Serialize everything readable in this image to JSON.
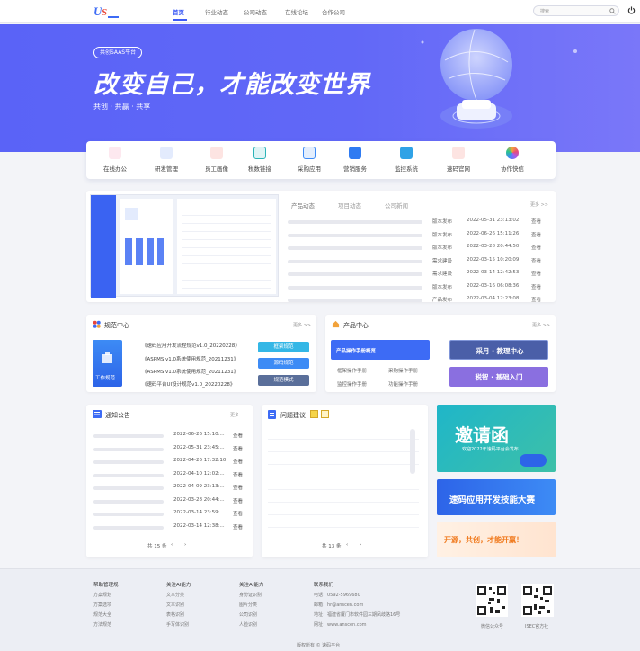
{
  "nav": {
    "items": [
      "首页",
      "行业动态",
      "公司动态",
      "在线论坛",
      "合作公司"
    ],
    "active": 0,
    "search_placeholder": "搜索"
  },
  "hero": {
    "badge": "共创SAAS平台",
    "title": "改变自己，才能改变世界",
    "subtitle": "共创 · 共赢 · 共享"
  },
  "apps": [
    {
      "label": "在线办公",
      "icon": "w-logo-icon",
      "color": "#e84a7a"
    },
    {
      "label": "研发管理",
      "icon": "u-logo-icon",
      "color": "#3d6bf5"
    },
    {
      "label": "员工画像",
      "icon": "id-card-icon",
      "color": "#e8453c"
    },
    {
      "label": "税数链接",
      "icon": "gear-box-icon",
      "color": "#2bb3b8"
    },
    {
      "label": "采购应用",
      "icon": "cart-icon",
      "color": "#3d8bf5"
    },
    {
      "label": "营销服务",
      "icon": "compass-icon",
      "color": "#2f7bf2"
    },
    {
      "label": "监控系统",
      "icon": "monitor-icon",
      "color": "#2fa2e6"
    },
    {
      "label": "速码官网",
      "icon": "u-logo-icon",
      "color": "#e8453c"
    },
    {
      "label": "协作快信",
      "icon": "circle-icon",
      "color": "#a35cf0"
    }
  ],
  "news": {
    "tabs": [
      "产品动态",
      "项目动态",
      "公司新闻"
    ],
    "more": "更多 >>",
    "rows": [
      {
        "cat": "版本发布",
        "date": "2022-05-31 23:13:02",
        "view": "查看"
      },
      {
        "cat": "版本发布",
        "date": "2022-06-26 15:11:26",
        "view": "查看"
      },
      {
        "cat": "版本发布",
        "date": "2022-03-28 20:44:50",
        "view": "查看"
      },
      {
        "cat": "需求建设",
        "date": "2022-03-15 10:20:09",
        "view": "查看"
      },
      {
        "cat": "需求建设",
        "date": "2022-03-14 12:42:53",
        "view": "查看"
      },
      {
        "cat": "版本发布",
        "date": "2022-03-16 06:08:36",
        "view": "查看"
      },
      {
        "cat": "产品发布",
        "date": "2022-03-04 12:23:08",
        "view": "查看"
      }
    ]
  },
  "spec": {
    "title": "规范中心",
    "more": "更多 >>",
    "side_label": "工作规范",
    "items": [
      "《速码应用开发流程规范v1.0_20220228》",
      "《ASPMS v1.0系统使用规范_20211231》",
      "《ASPMS v1.0系统使用规范_20211231》",
      "《速码平台UI设计规范v1.0_20220228》"
    ],
    "buttons": [
      "框架规范",
      "源码规范",
      "规范模式"
    ]
  },
  "product": {
    "title": "产品中心",
    "more": "更多 >>",
    "guide_title": "产品操作手册概览",
    "links": [
      "框架操作手册",
      "采购操作手册",
      "监控操作手册",
      "功能操作手册"
    ],
    "banner1": "采月 · 教理中心",
    "banner2": "税智 · 基础入门"
  },
  "notice": {
    "title": "通知公告",
    "more": "更多",
    "rows": [
      {
        "date": "2022-06-26 15:10:...",
        "view": "查看"
      },
      {
        "date": "2022-05-31 23:45:...",
        "view": "查看"
      },
      {
        "date": "2022-04-26 17:32:10",
        "view": "查看"
      },
      {
        "date": "2022-04-10 12:02:...",
        "view": "查看"
      },
      {
        "date": "2022-04-09 23:13:...",
        "view": "查看"
      },
      {
        "date": "2022-03-28 20:44:...",
        "view": "查看"
      },
      {
        "date": "2022-03-14 23:59:...",
        "view": "查看"
      },
      {
        "date": "2022-03-14 12:38:...",
        "view": "查看"
      }
    ],
    "pager": {
      "total": "共 15 条",
      "prev": "‹",
      "next": "›"
    }
  },
  "issues": {
    "title": "问题建议",
    "pager": {
      "total": "共 13 条",
      "prev": "‹",
      "next": "›"
    }
  },
  "ads": {
    "invite": "邀请函",
    "invite_sub": "欢迎2022年速码平台会发布",
    "dev_contest": "速码应用开发技能大赛",
    "promo": "开源，共创，才能开赢！"
  },
  "footer": {
    "cols": [
      {
        "head": "帮助管理规",
        "items": [
          "方案规划",
          "方案选项",
          "规范大全",
          "方法规范"
        ]
      },
      {
        "head": "关注AI能力",
        "items": [
          "文本分类",
          "文本识别",
          "表格识别",
          "手写体识别"
        ]
      },
      {
        "head": "关注AI能力",
        "items": [
          "身份证识别",
          "图片分类",
          "公司识别",
          "人脸识别"
        ]
      },
      {
        "head": "联系我们",
        "items": [
          "电话：0592-5969680",
          "邮箱：hr@anscen.com",
          "地址：福建省厦门市软件园三期凤歧路16号",
          "网址：www.anscen.com"
        ]
      }
    ],
    "qr": [
      "微信公众号",
      "ISEC官方社"
    ],
    "copyright": "版权所有 © 速码平台"
  }
}
